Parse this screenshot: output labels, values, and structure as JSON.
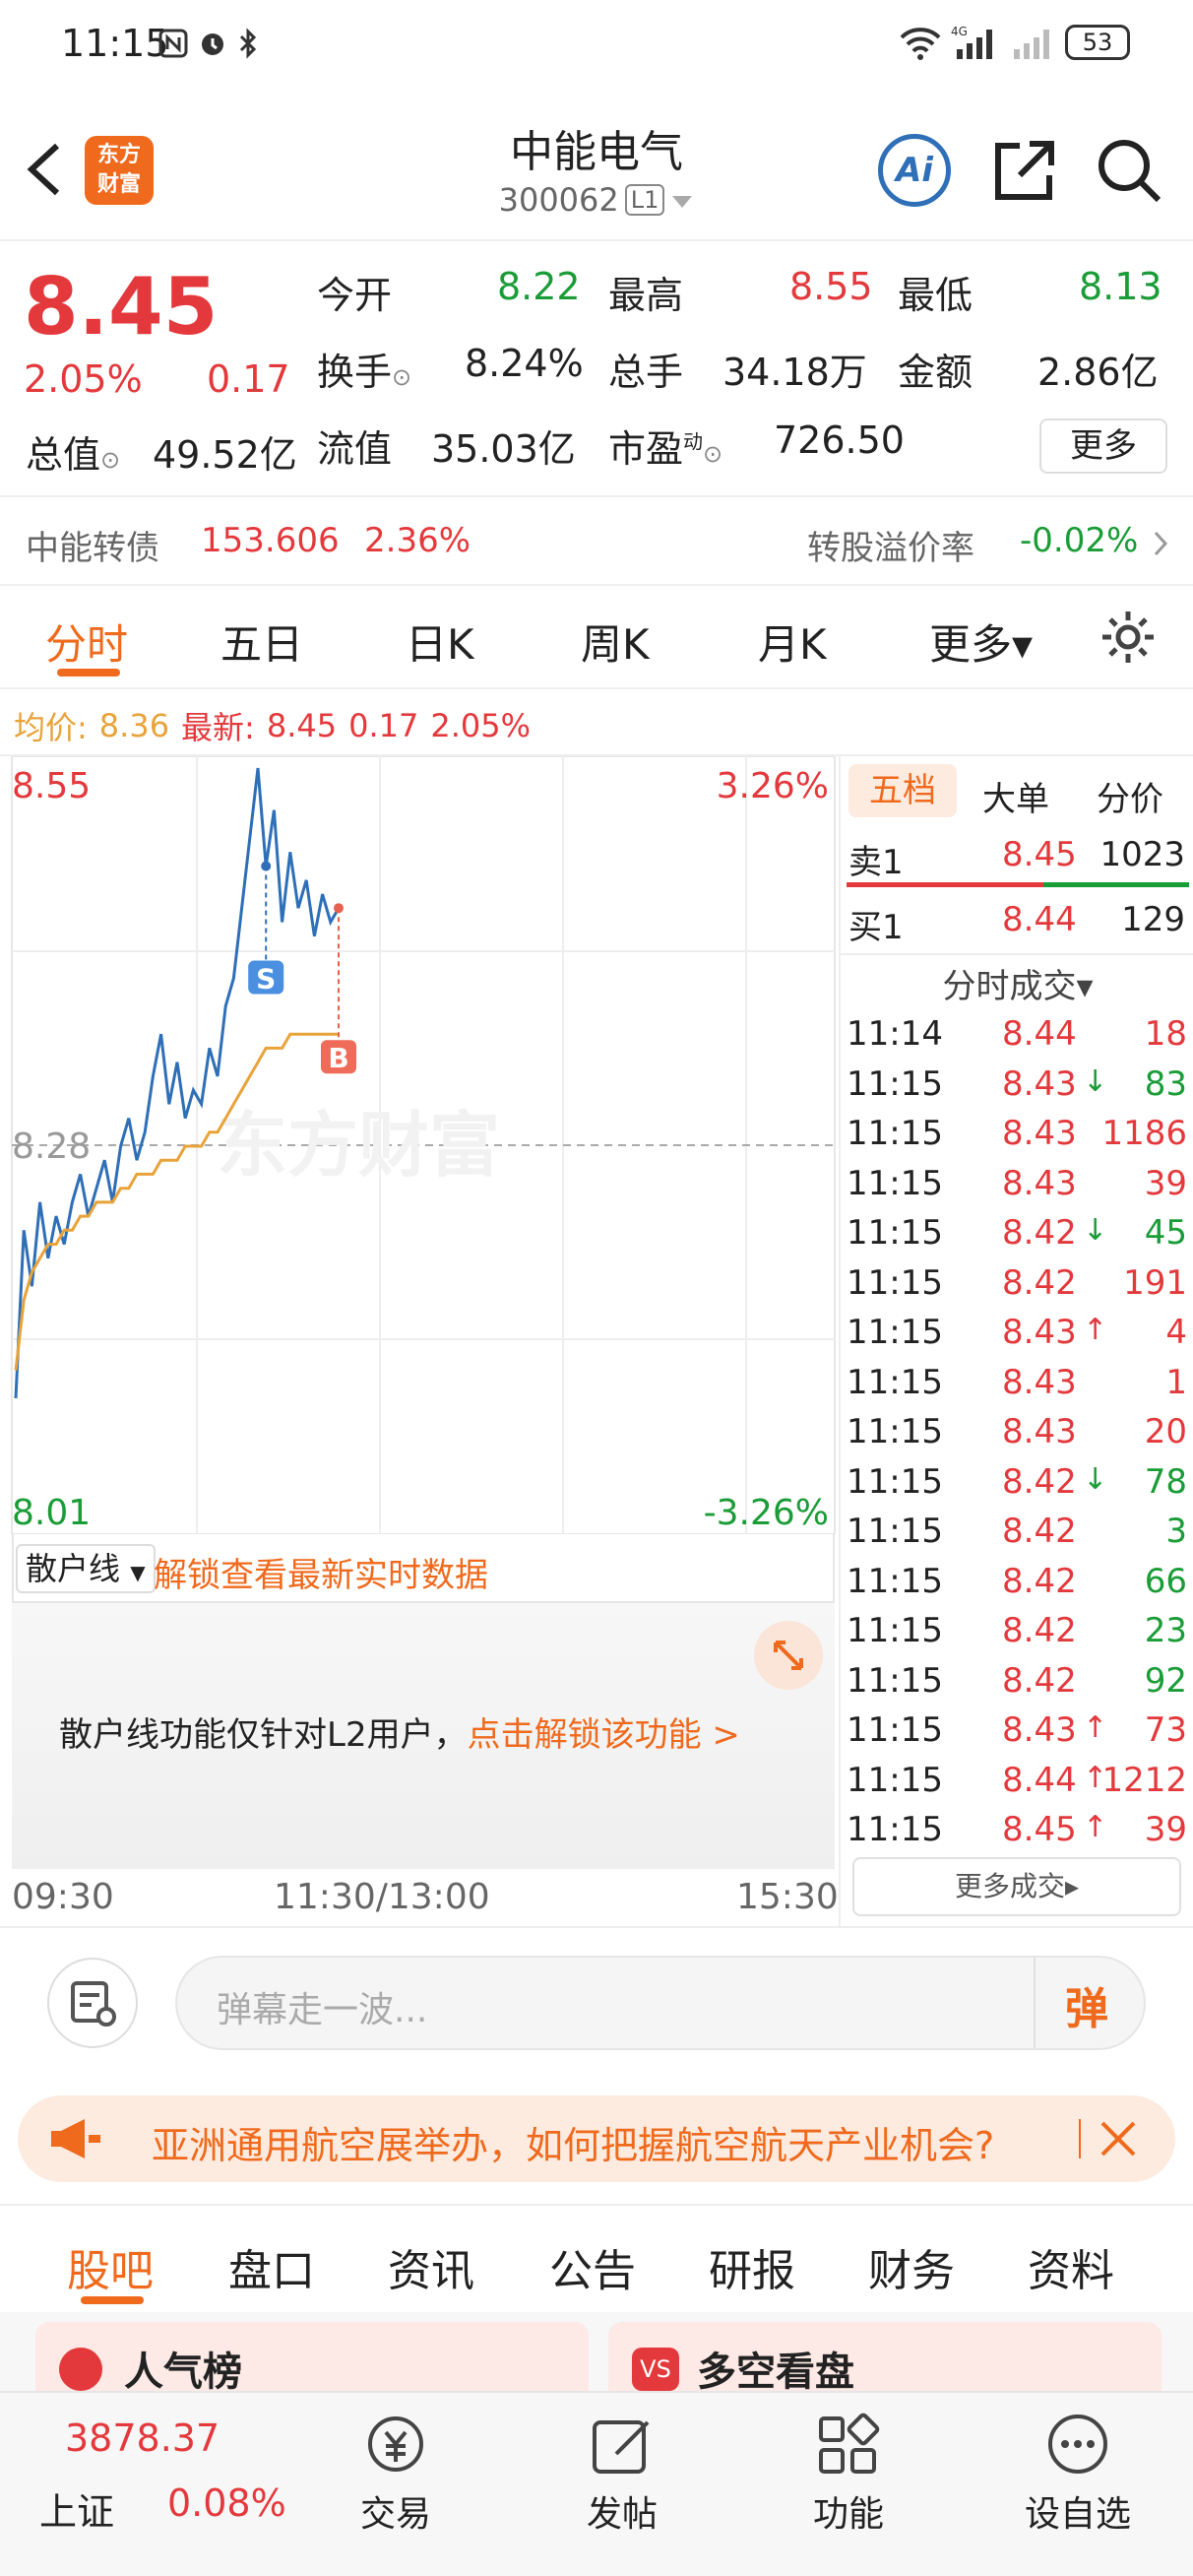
{
  "status": {
    "time": "11:15",
    "battery": "53",
    "network": "4G"
  },
  "header": {
    "title": "中能电气",
    "code": "300062",
    "level": "L1",
    "logo_line1": "东方",
    "logo_line2": "财富",
    "ai_label": "Ai"
  },
  "quote": {
    "price": "8.45",
    "change_pct": "2.05%",
    "change": "0.17",
    "open_label": "今开",
    "open": "8.22",
    "high_label": "最高",
    "high": "8.55",
    "low_label": "最低",
    "low": "8.13",
    "turnover_label": "换手",
    "turnover": "8.24%",
    "volume_label": "总手",
    "volume": "34.18万",
    "amount_label": "金额",
    "amount": "2.86亿",
    "mktcap_label": "总值",
    "mktcap": "49.52亿",
    "float_label": "流值",
    "float": "35.03亿",
    "pe_label": "市盈",
    "pe_sup": "动",
    "pe": "726.50",
    "more_label": "更多"
  },
  "bond": {
    "label": "中能转债",
    "price": "153.606",
    "pct": "2.36%",
    "premium_label": "转股溢价率",
    "premium": "-0.02%"
  },
  "tabs": [
    "分时",
    "五日",
    "日K",
    "周K",
    "月K",
    "更多▾"
  ],
  "avg": {
    "avg_label": "均价:",
    "avg": "8.36",
    "latest_label": "最新:",
    "latest": "8.45",
    "chg": "0.17",
    "pct": "2.05%"
  },
  "chart_labels": {
    "top_price": "8.55",
    "top_pct": "3.26%",
    "mid_price": "8.28",
    "bottom_price": "8.01",
    "bottom_pct": "-3.26%",
    "watermark": "东方财富",
    "marker_s": "S",
    "marker_b": "B"
  },
  "chart_data": {
    "type": "line",
    "ylim": [
      8.01,
      8.55
    ],
    "x_range": [
      "09:30",
      "15:30"
    ],
    "series": [
      {
        "values": [
          8.1,
          8.22,
          8.18,
          8.24,
          8.2,
          8.23,
          8.21,
          8.24,
          8.26,
          8.23,
          8.25,
          8.27,
          8.24,
          8.28,
          8.3,
          8.27,
          8.29,
          8.33,
          8.36,
          8.31,
          8.34,
          8.3,
          8.32,
          8.31,
          8.35,
          8.33,
          8.38,
          8.4,
          8.45,
          8.5,
          8.55,
          8.48,
          8.52,
          8.44,
          8.49,
          8.45,
          8.47,
          8.43,
          8.46,
          8.44,
          8.45
        ]
      },
      {
        "values": [
          8.12,
          8.17,
          8.19,
          8.2,
          8.21,
          8.21,
          8.22,
          8.22,
          8.23,
          8.23,
          8.24,
          8.24,
          8.24,
          8.25,
          8.25,
          8.26,
          8.26,
          8.26,
          8.27,
          8.27,
          8.27,
          8.28,
          8.28,
          8.28,
          8.29,
          8.29,
          8.3,
          8.31,
          8.32,
          8.33,
          8.34,
          8.35,
          8.35,
          8.35,
          8.36,
          8.36,
          8.36,
          8.36,
          8.36,
          8.36,
          8.36
        ]
      }
    ]
  },
  "depth": {
    "tabs": [
      "五档",
      "大单",
      "分价"
    ],
    "sell_label": "卖1",
    "sell_price": "8.45",
    "sell_vol": "1023",
    "buy_label": "买1",
    "buy_price": "8.44",
    "buy_vol": "129",
    "trades_title": "分时成交▾",
    "more_trades": "更多成交▸",
    "trades": [
      {
        "t": "11:14",
        "p": "8.44",
        "d": "",
        "v": "18",
        "c": "red"
      },
      {
        "t": "11:15",
        "p": "8.43",
        "d": "↓",
        "v": "83",
        "c": "green"
      },
      {
        "t": "11:15",
        "p": "8.43",
        "d": "",
        "v": "1186",
        "c": "red"
      },
      {
        "t": "11:15",
        "p": "8.43",
        "d": "",
        "v": "39",
        "c": "red"
      },
      {
        "t": "11:15",
        "p": "8.42",
        "d": "↓",
        "v": "45",
        "c": "green"
      },
      {
        "t": "11:15",
        "p": "8.42",
        "d": "",
        "v": "191",
        "c": "red"
      },
      {
        "t": "11:15",
        "p": "8.43",
        "d": "↑",
        "v": "4",
        "c": "red"
      },
      {
        "t": "11:15",
        "p": "8.43",
        "d": "",
        "v": "1",
        "c": "red"
      },
      {
        "t": "11:15",
        "p": "8.43",
        "d": "",
        "v": "20",
        "c": "red"
      },
      {
        "t": "11:15",
        "p": "8.42",
        "d": "↓",
        "v": "78",
        "c": "green"
      },
      {
        "t": "11:15",
        "p": "8.42",
        "d": "",
        "v": "3",
        "c": "green"
      },
      {
        "t": "11:15",
        "p": "8.42",
        "d": "",
        "v": "66",
        "c": "green"
      },
      {
        "t": "11:15",
        "p": "8.42",
        "d": "",
        "v": "23",
        "c": "green"
      },
      {
        "t": "11:15",
        "p": "8.42",
        "d": "",
        "v": "92",
        "c": "green"
      },
      {
        "t": "11:15",
        "p": "8.43",
        "d": "↑",
        "v": "73",
        "c": "red"
      },
      {
        "t": "11:15",
        "p": "8.44",
        "d": "↑",
        "v": "1212",
        "c": "red"
      },
      {
        "t": "11:15",
        "p": "8.45",
        "d": "↑",
        "v": "39",
        "c": "red"
      }
    ]
  },
  "retail": {
    "select_label": "散户线",
    "unlock_link": "解锁查看最新实时数据",
    "notice": "散户线功能仅针对L2用户，",
    "notice_link": "点击解锁该功能 >"
  },
  "time_axis": {
    "start": "09:30",
    "mid": "11:30/13:00",
    "end": "15:30"
  },
  "danmu": {
    "placeholder": "弹幕走一波...",
    "send_label": "弹"
  },
  "banner": {
    "text": "亚洲通用航空展举办，如何把握航空航天产业机会?"
  },
  "subtabs": [
    "股吧",
    "盘口",
    "资讯",
    "公告",
    "研报",
    "财务",
    "资料"
  ],
  "cards": {
    "left": "人气榜",
    "right": "多空看盘"
  },
  "bottom_nav": {
    "index_value": "3878.37",
    "index_name": "上证",
    "index_pct": "0.08%",
    "items": [
      "交易",
      "发帖",
      "功能",
      "设自选"
    ]
  },
  "colors": {
    "red": "#e4393c",
    "green": "#1a9c37",
    "orange": "#f06a1d",
    "blue": "#2e6fb7",
    "avg_line": "#e8a33a"
  }
}
